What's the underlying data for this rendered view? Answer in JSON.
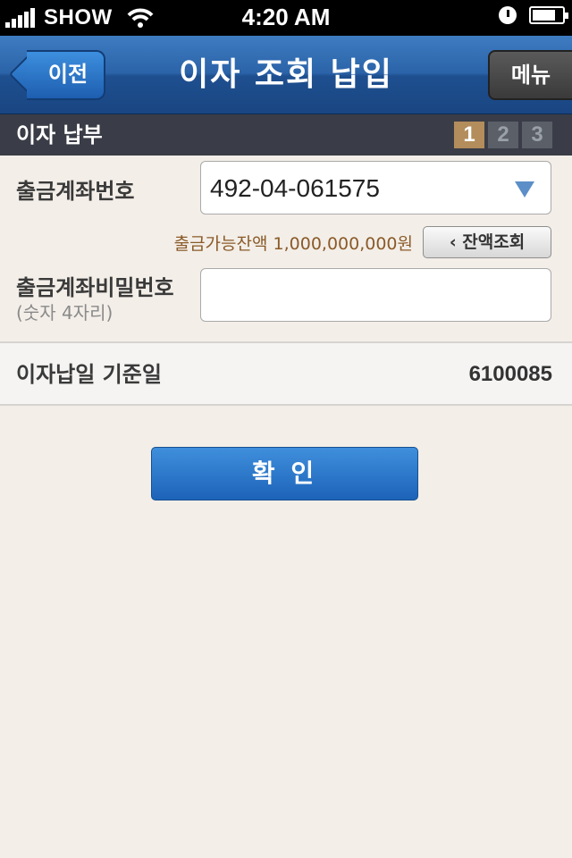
{
  "status_bar": {
    "carrier": "SHOW",
    "time": "4:20 AM"
  },
  "nav": {
    "back_label": "이전",
    "title": "이자 조회 납입",
    "menu_label": "메뉴"
  },
  "section": {
    "title": "이자 납부",
    "steps": [
      "1",
      "2",
      "3"
    ],
    "active_step": 1
  },
  "form": {
    "account_label": "출금계좌번호",
    "account_value": "492-04-061575",
    "balance_text": "출금가능잔액 1,000,000,000원",
    "balance_button": "‹ 잔액조회",
    "password_label": "출금계좌비밀번호",
    "password_hint": "(숫자 4자리)",
    "password_value": "",
    "date_label": "이자납일 기준일",
    "date_value": "6100085"
  },
  "confirm_label": "확 인",
  "colors": {
    "nav_blue": "#2b63a8",
    "step_active": "#b38d5c",
    "balance_text": "#8a5a28",
    "confirm_blue": "#1d63b9"
  }
}
